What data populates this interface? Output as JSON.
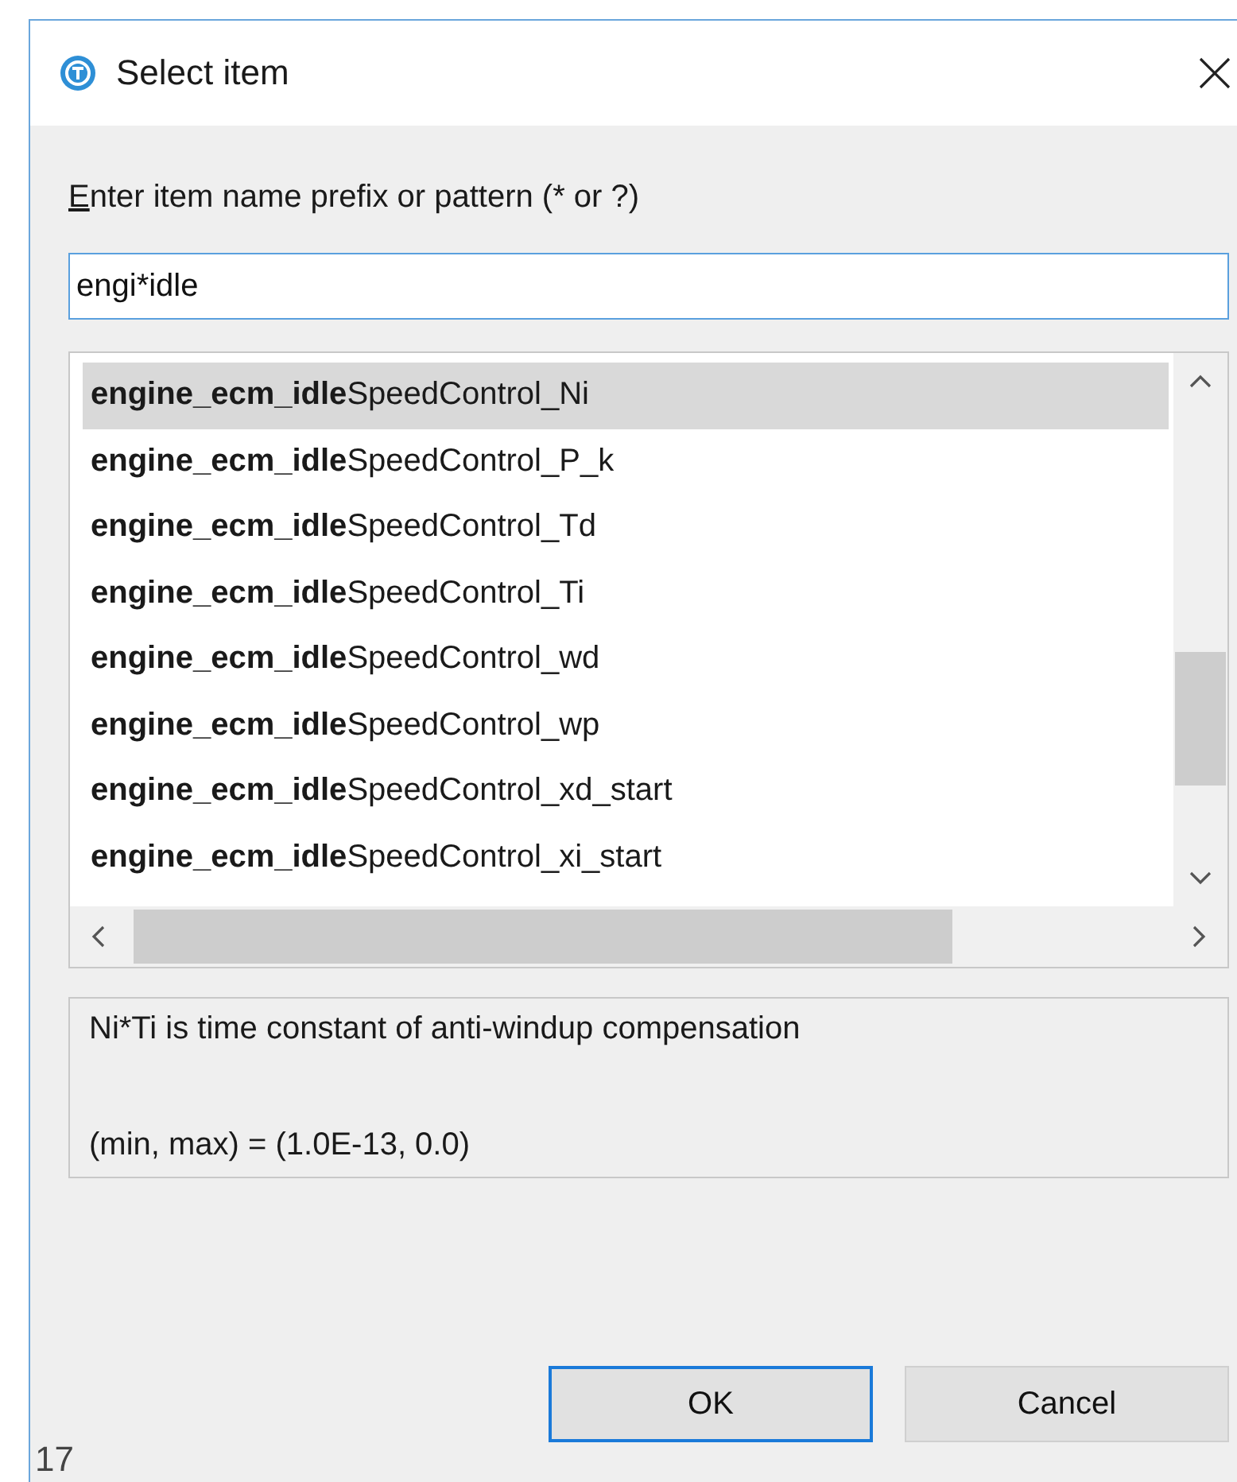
{
  "window": {
    "title": "Select item"
  },
  "prompt": {
    "label": "Enter item name prefix or pattern (* or ?)"
  },
  "search": {
    "value": "engi*idle"
  },
  "items": [
    {
      "label": "**engine_ecm_idle**SpeedControl_Ni",
      "selected": true
    },
    {
      "label": "**engine_ecm_idle**SpeedControl_P_k",
      "selected": false
    },
    {
      "label": "**engine_ecm_idle**SpeedControl_Td",
      "selected": false
    },
    {
      "label": "**engine_ecm_idle**SpeedControl_Ti",
      "selected": false
    },
    {
      "label": "**engine_ecm_idle**SpeedControl_wd",
      "selected": false
    },
    {
      "label": "**engine_ecm_idle**SpeedControl_wp",
      "selected": false
    },
    {
      "label": "**engine_ecm_idle**SpeedControl_xd_start",
      "selected": false
    },
    {
      "label": "**engine_ecm_idle**SpeedControl_xi_start",
      "selected": false
    }
  ],
  "details": {
    "lines": [
      "Ni*Ti is time constant of anti-windup compensation",
      "(min, max) = (1.0E-13, 0.0)"
    ]
  },
  "buttons": [
    {
      "label": "OK",
      "default": true
    },
    {
      "label": "Cancel",
      "default": false
    }
  ],
  "background_text": "17"
}
